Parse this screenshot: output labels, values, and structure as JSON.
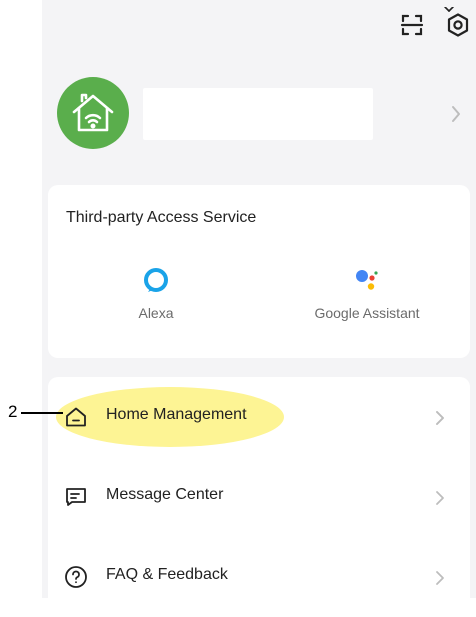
{
  "header": {
    "scan_icon": "scan-icon",
    "settings_icon": "settings-hexagon-icon"
  },
  "profile": {
    "avatar_icon": "home-wifi-icon",
    "avatar_color": "#5aae4c",
    "name": ""
  },
  "access": {
    "title": "Third-party Access Service",
    "services": [
      {
        "label": "Alexa",
        "icon": "alexa-icon"
      },
      {
        "label": "Google Assistant",
        "icon": "google-assistant-icon"
      }
    ]
  },
  "menu": {
    "items": [
      {
        "label": "Home Management",
        "icon": "home-icon"
      },
      {
        "label": "Message Center",
        "icon": "message-icon"
      },
      {
        "label": "FAQ & Feedback",
        "icon": "help-icon"
      }
    ]
  },
  "annotation": {
    "callout_number": "2",
    "highlight_color": "#fdf38e"
  }
}
